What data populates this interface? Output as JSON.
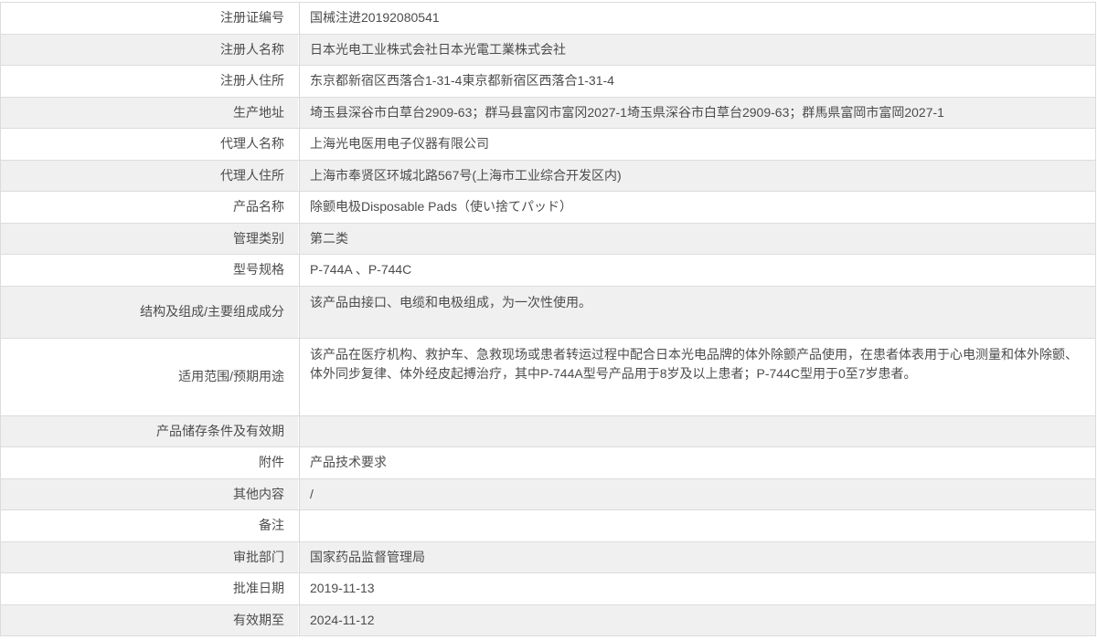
{
  "colors": {
    "page_bg": "#ffffff",
    "row_alt_bg": "#f0f0f0",
    "border": "#dcdcdc",
    "divider": "#d9d9d9",
    "text": "#4c4c4c"
  },
  "table": {
    "rows": [
      {
        "label": "注册证编号",
        "value": "国械注进20192080541"
      },
      {
        "label": "注册人名称",
        "value": "日本光电工业株式会社日本光電工業株式会社"
      },
      {
        "label": "注册人住所",
        "value": "东京都新宿区西落合1-31-4東京都新宿区西落合1-31-4"
      },
      {
        "label": "生产地址",
        "value": "埼玉县深谷市白草台2909-63；群马县富冈市富冈2027-1埼玉県深谷市白草台2909-63；群馬県富岡市富岡2027-1"
      },
      {
        "label": "代理人名称",
        "value": "上海光电医用电子仪器有限公司"
      },
      {
        "label": "代理人住所",
        "value": "上海市奉贤区环城北路567号(上海市工业综合开发区内)"
      },
      {
        "label": "产品名称",
        "value": "除颤电极Disposable Pads（使い捨てパッド）"
      },
      {
        "label": "管理类别",
        "value": "第二类"
      },
      {
        "label": "型号规格",
        "value": "P-744A 、P-744C"
      },
      {
        "label": "结构及组成/主要组成成分",
        "value": "该产品由接口、电缆和电极组成，为一次性使用。"
      },
      {
        "label": "适用范围/预期用途",
        "value": "该产品在医疗机构、救护车、急救现场或患者转运过程中配合日本光电品牌的体外除颤产品使用，在患者体表用于心电测量和体外除颤、体外同步复律、体外经皮起搏治疗，其中P-744A型号产品用于8岁及以上患者；P-744C型用于0至7岁患者。"
      },
      {
        "label": "产品储存条件及有效期",
        "value": ""
      },
      {
        "label": "附件",
        "value": "产品技术要求"
      },
      {
        "label": "其他内容",
        "value": "/"
      },
      {
        "label": "备注",
        "value": ""
      },
      {
        "label": "审批部门",
        "value": "国家药品监督管理局"
      },
      {
        "label": "批准日期",
        "value": "2019-11-13"
      },
      {
        "label": "有效期至",
        "value": "2024-11-12"
      }
    ]
  }
}
